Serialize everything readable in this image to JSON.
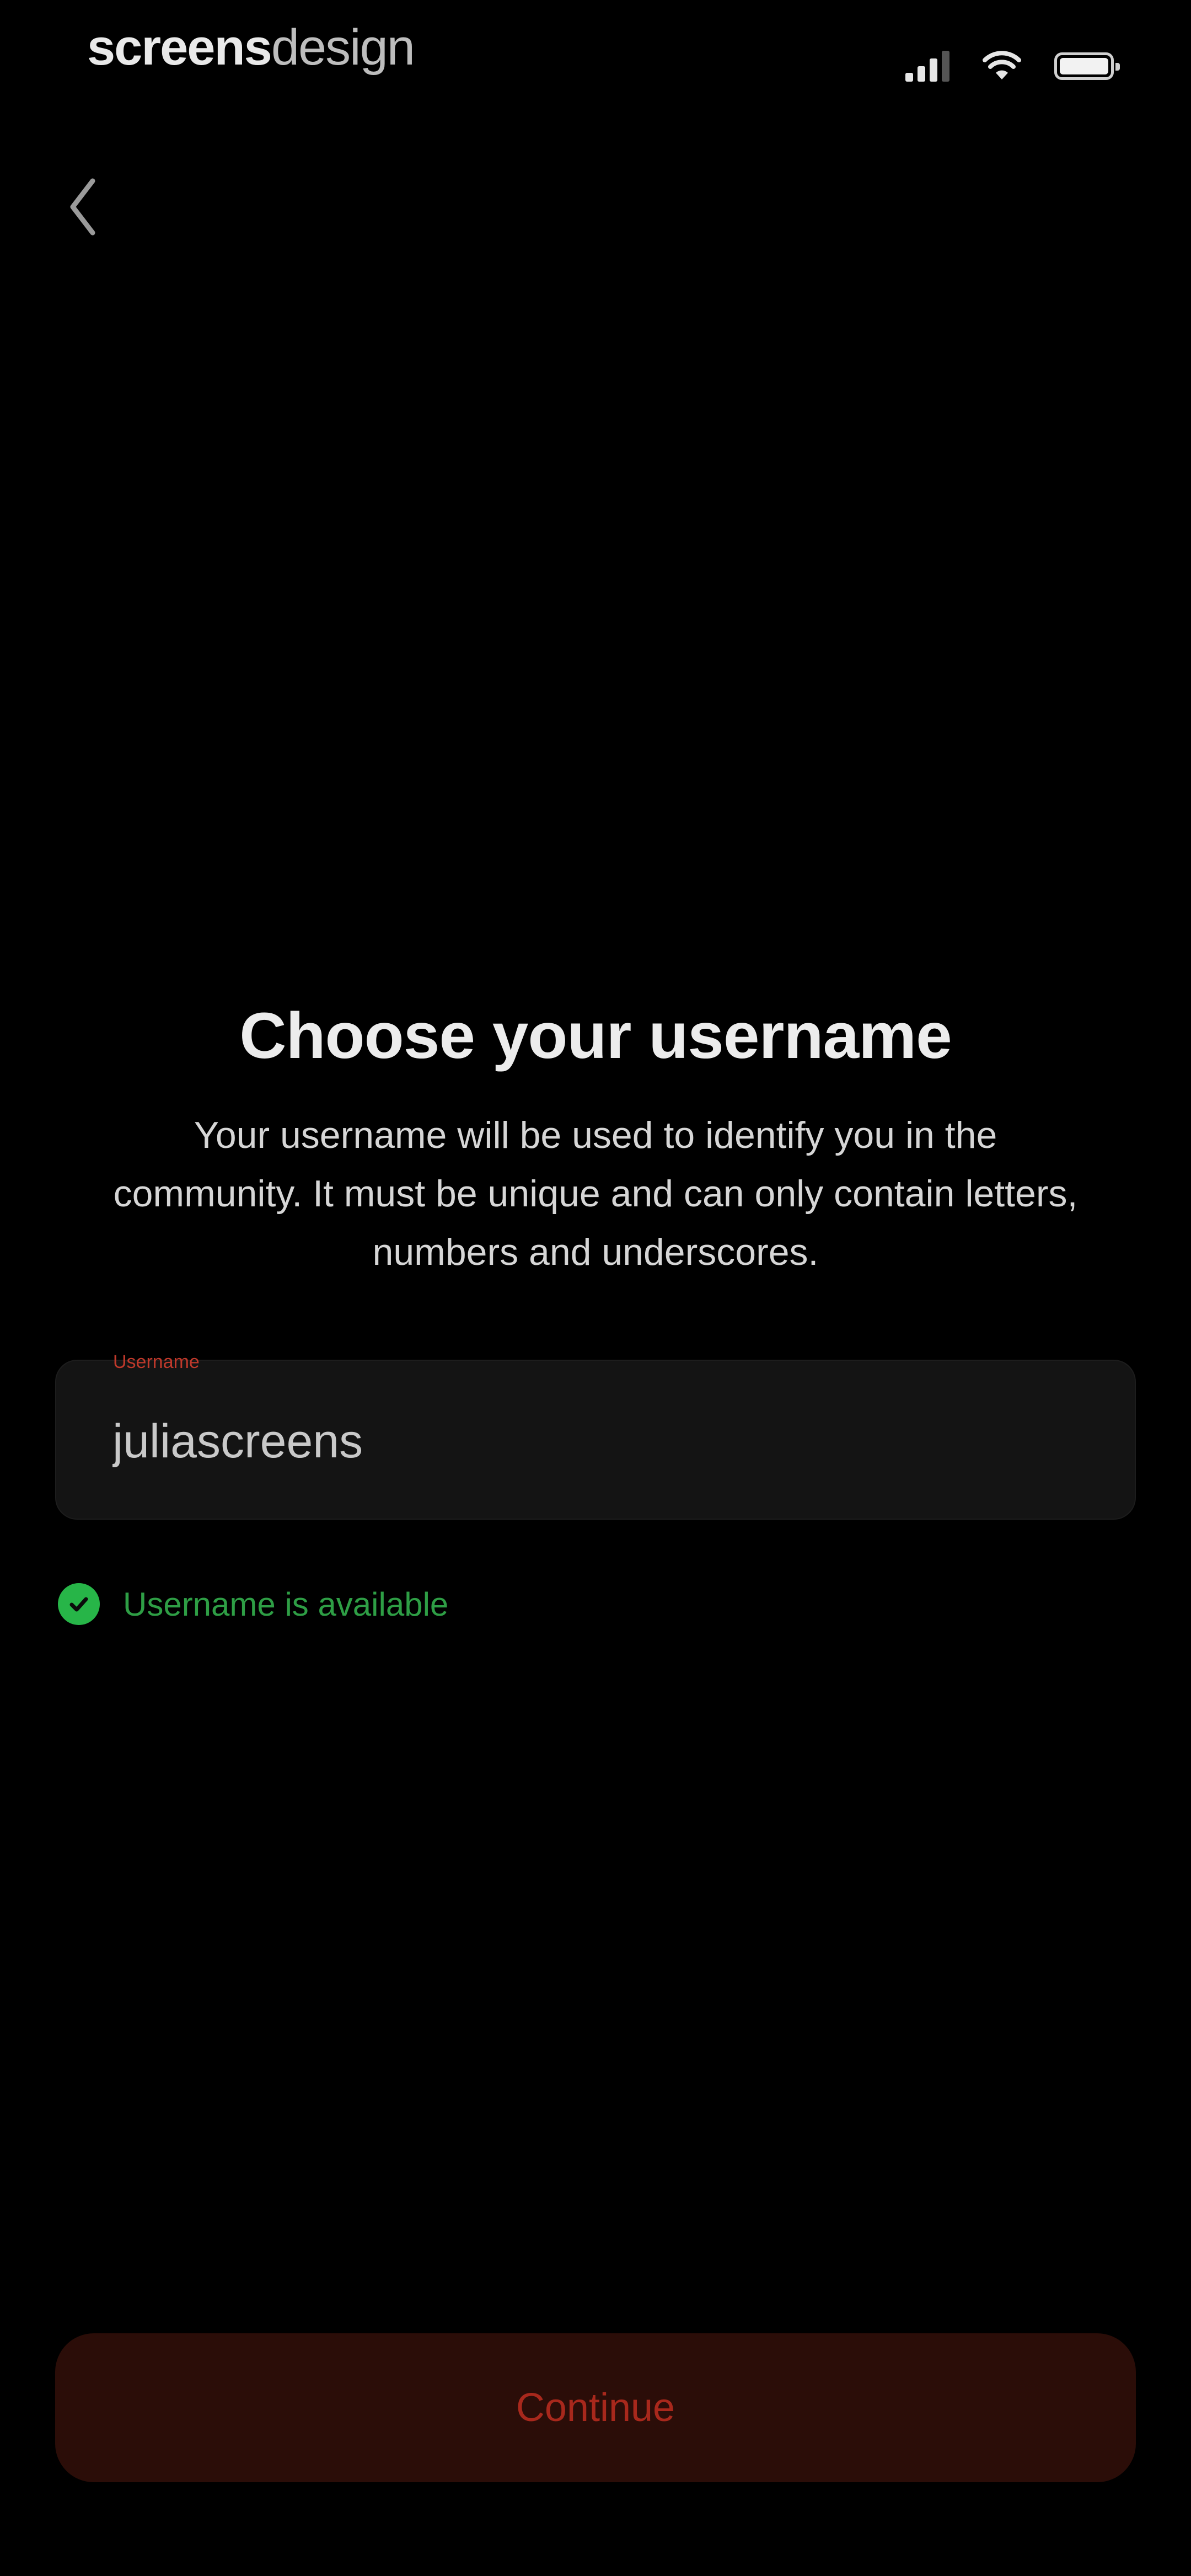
{
  "status_bar": {
    "brand_bold": "screens",
    "brand_light": "design",
    "icons": [
      "signal-icon",
      "wifi-icon",
      "battery-icon"
    ]
  },
  "header": {
    "back_icon": "chevron-left-icon"
  },
  "main": {
    "title": "Choose your username",
    "description": "Your username will be used to identify you in the community. It must be unique and can only contain letters, numbers and underscores."
  },
  "username_field": {
    "label": "Username",
    "value": "juliascreens"
  },
  "availability": {
    "icon": "check-circle-icon",
    "text": "Username is available"
  },
  "footer": {
    "continue_label": "Continue"
  },
  "colors": {
    "background": "#000000",
    "accent_red": "#a8281c",
    "button_bg": "#2b0d08",
    "success_green": "#27b548",
    "input_bg": "#141414"
  }
}
